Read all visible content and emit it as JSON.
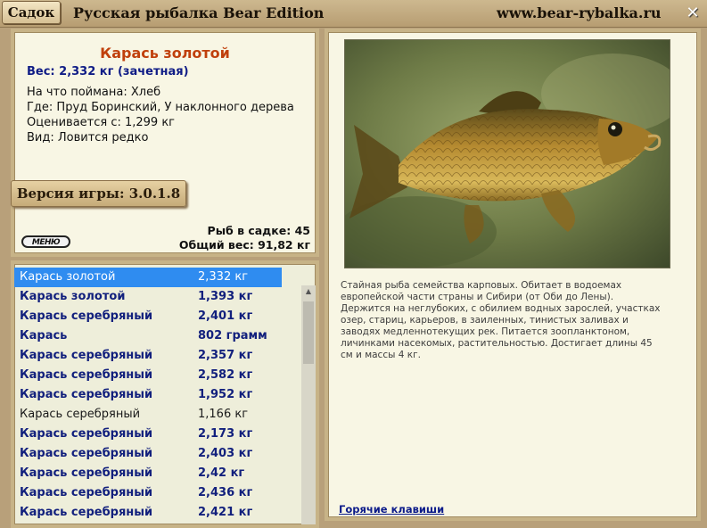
{
  "titlebar": {
    "sadok_button": "Садок",
    "app_title": "Русская рыбалка Bear Edition",
    "site_url": "www.bear-rybalka.ru",
    "close_glyph": "✕"
  },
  "info": {
    "fish_name": "Карась золотой",
    "weight_line": "Вес: 2,332 кг (зачетная)",
    "bait_line": "На что поймана: Хлеб",
    "place_line": "Где: Пруд Боринский, У наклонного дерева",
    "estimate_line": "Оценивается с: 1,299 кг",
    "kind_line": "Вид: Ловится редко",
    "version": "Версия игры: 3.0.1.8",
    "menu_logo": "МЕНЮ",
    "fish_count_line": "Рыб в садке: 45",
    "total_weight_line": "Общий вес: 91,82 кг"
  },
  "fish_list": [
    {
      "name": "Карась золотой",
      "weight": "2,332 кг",
      "style": "selected"
    },
    {
      "name": "Карась золотой",
      "weight": "1,393 кг",
      "style": "trophy"
    },
    {
      "name": "Карась серебряный",
      "weight": "2,401 кг",
      "style": "trophy"
    },
    {
      "name": "Карась",
      "weight": "802 грамм",
      "style": "trophy"
    },
    {
      "name": "Карась серебряный",
      "weight": "2,357 кг",
      "style": "trophy"
    },
    {
      "name": "Карась серебряный",
      "weight": "2,582 кг",
      "style": "trophy"
    },
    {
      "name": "Карась серебряный",
      "weight": "1,952 кг",
      "style": "trophy"
    },
    {
      "name": "Карась серебряный",
      "weight": "1,166 кг",
      "style": "plain"
    },
    {
      "name": "Карась серебряный",
      "weight": "2,173 кг",
      "style": "trophy"
    },
    {
      "name": "Карась серебряный",
      "weight": "2,403 кг",
      "style": "trophy"
    },
    {
      "name": "Карась серебряный",
      "weight": "2,42 кг",
      "style": "trophy"
    },
    {
      "name": "Карась серебряный",
      "weight": "2,436 кг",
      "style": "trophy"
    },
    {
      "name": "Карась серебряный",
      "weight": "2,421 кг",
      "style": "trophy"
    }
  ],
  "detail": {
    "description": "Стайная рыба семейства карповых. Обитает в водоемах европейской части страны и Сибири (от Оби до Лены). Держится на неглубоких, с обилием водных зарослей, участках озер, стариц, карьеров, в заиленных, тинистых заливах и заводях медленнотекущих рек. Питается зоопланктоном, личинками насекомых, растительностью. Достигает длины 45 см и массы 4 кг.",
    "hotkeys_link": "Горячие клавиши"
  },
  "colors": {
    "trophy_text": "#12207d",
    "fish_name": "#c0400c",
    "selected_row": "#2f8cf0"
  }
}
